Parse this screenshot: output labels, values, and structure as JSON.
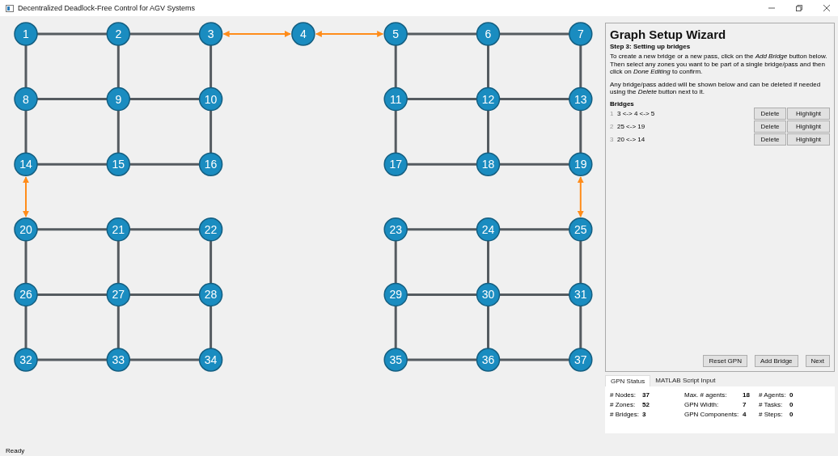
{
  "window": {
    "title": "Decentralized Deadlock-Free Control for AGV Systems"
  },
  "graph": {
    "rows": [
      [
        {
          "label": "1",
          "right": {
            "kind": "edge"
          },
          "down": {
            "kind": "edge"
          }
        },
        {
          "label": "2",
          "right": {
            "kind": "edge"
          },
          "down": {
            "kind": "edge"
          }
        },
        {
          "label": "3",
          "right": {
            "kind": "bridge"
          },
          "down": {
            "kind": "edge"
          }
        },
        {
          "label": "4",
          "right": {
            "kind": "bridge"
          }
        },
        {
          "label": "5",
          "right": {
            "kind": "edge"
          },
          "down": {
            "kind": "edge"
          }
        },
        {
          "label": "6",
          "right": {
            "kind": "edge"
          },
          "down": {
            "kind": "edge"
          }
        },
        {
          "label": "7",
          "down": {
            "kind": "edge"
          }
        }
      ],
      [
        {
          "label": "8",
          "right": {
            "kind": "edge"
          },
          "down": {
            "kind": "edge"
          }
        },
        {
          "label": "9",
          "right": {
            "kind": "edge"
          },
          "down": {
            "kind": "edge"
          }
        },
        {
          "label": "10",
          "down": {
            "kind": "edge"
          }
        },
        null,
        {
          "label": "11",
          "right": {
            "kind": "edge"
          },
          "down": {
            "kind": "edge"
          }
        },
        {
          "label": "12",
          "right": {
            "kind": "edge"
          },
          "down": {
            "kind": "edge"
          }
        },
        {
          "label": "13",
          "down": {
            "kind": "edge"
          }
        }
      ],
      [
        {
          "label": "14",
          "right": {
            "kind": "edge"
          },
          "down": {
            "kind": "bridge"
          }
        },
        {
          "label": "15",
          "right": {
            "kind": "edge"
          }
        },
        {
          "label": "16"
        },
        null,
        {
          "label": "17",
          "right": {
            "kind": "edge"
          }
        },
        {
          "label": "18",
          "right": {
            "kind": "edge"
          }
        },
        {
          "label": "19",
          "down": {
            "kind": "bridge"
          }
        }
      ],
      [
        {
          "label": "20",
          "right": {
            "kind": "edge"
          },
          "down": {
            "kind": "edge"
          }
        },
        {
          "label": "21",
          "right": {
            "kind": "edge"
          },
          "down": {
            "kind": "edge"
          }
        },
        {
          "label": "22",
          "down": {
            "kind": "edge"
          }
        },
        null,
        {
          "label": "23",
          "right": {
            "kind": "edge"
          },
          "down": {
            "kind": "edge"
          }
        },
        {
          "label": "24",
          "right": {
            "kind": "edge"
          },
          "down": {
            "kind": "edge"
          }
        },
        {
          "label": "25",
          "down": {
            "kind": "edge"
          }
        }
      ],
      [
        {
          "label": "26",
          "right": {
            "kind": "edge"
          },
          "down": {
            "kind": "edge"
          }
        },
        {
          "label": "27",
          "right": {
            "kind": "edge"
          },
          "down": {
            "kind": "edge"
          }
        },
        {
          "label": "28",
          "down": {
            "kind": "edge"
          }
        },
        null,
        {
          "label": "29",
          "right": {
            "kind": "edge"
          },
          "down": {
            "kind": "edge"
          }
        },
        {
          "label": "30",
          "right": {
            "kind": "edge"
          },
          "down": {
            "kind": "edge"
          }
        },
        {
          "label": "31",
          "down": {
            "kind": "edge"
          }
        }
      ],
      [
        {
          "label": "32",
          "right": {
            "kind": "edge"
          }
        },
        {
          "label": "33",
          "right": {
            "kind": "edge"
          }
        },
        {
          "label": "34"
        },
        null,
        {
          "label": "35",
          "right": {
            "kind": "edge"
          }
        },
        {
          "label": "36",
          "right": {
            "kind": "edge"
          }
        },
        {
          "label": "37"
        }
      ]
    ]
  },
  "wizard": {
    "title": "Graph Setup Wizard",
    "step": "Step 3: Setting up bridges",
    "paragraphs": [
      "To create a new bridge or a new pass, click on the *Add Bridge* button below. Then select any zones you want to be part of a single bridge/pass and then click on *Done Editing* to confirm.",
      "Any bridge/pass added will be shown below and can be deleted if needed using the *Delete* button next to it."
    ],
    "list_title": "Bridges",
    "bridges": [
      {
        "number": "1",
        "text": "3 <-> 4 <-> 5",
        "delete": "Delete",
        "highlight": "Highlight"
      },
      {
        "number": "2",
        "text": "25 <-> 19",
        "delete": "Delete",
        "highlight": "Highlight"
      },
      {
        "number": "3",
        "text": "20 <-> 14",
        "delete": "Delete",
        "highlight": "Highlight"
      }
    ],
    "buttons": [
      "Reset GPN",
      "Add Bridge",
      "Next"
    ]
  },
  "tabs": [
    {
      "label": "GPN Status",
      "selected": true
    },
    {
      "label": "MATLAB Script Input",
      "selected": false
    }
  ],
  "status": [
    [
      {
        "label": "# Nodes:",
        "value": "37"
      },
      {
        "label": "# Zones:",
        "value": "52"
      },
      {
        "label": "# Bridges:",
        "value": "3"
      }
    ],
    [
      {
        "label": "Max. # agents:",
        "value": "18"
      },
      {
        "label": "GPN Width:",
        "value": "7"
      },
      {
        "label": "GPN Components:",
        "value": "4"
      }
    ],
    [
      {
        "label": "# Agents:",
        "value": "0"
      },
      {
        "label": "# Tasks:",
        "value": "0"
      },
      {
        "label": "# Steps:",
        "value": "0"
      }
    ]
  ],
  "status_bar": "Ready"
}
